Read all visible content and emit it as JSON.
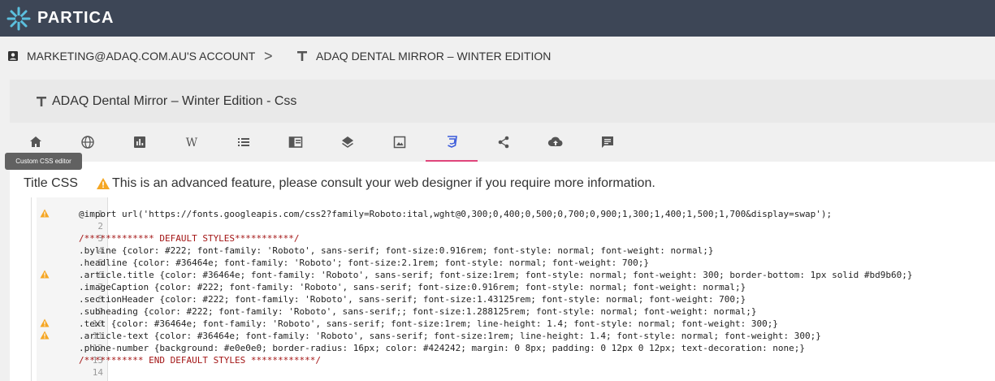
{
  "app": {
    "brand": "PARTICA"
  },
  "breadcrumb": {
    "account": "MARKETING@ADAQ.COM.AU'S ACCOUNT",
    "separator": ">",
    "document": "ADAQ DENTAL MIRROR – WINTER EDITION"
  },
  "panel": {
    "title": "ADAQ Dental Mirror – Winter Edition - Css"
  },
  "tabs": [
    {
      "icon": "home-icon"
    },
    {
      "icon": "globe-icon"
    },
    {
      "icon": "chart-icon"
    },
    {
      "icon": "wikipedia-icon",
      "glyph": "W"
    },
    {
      "icon": "list-icon"
    },
    {
      "icon": "layout-icon"
    },
    {
      "icon": "layers-icon"
    },
    {
      "icon": "image-icon"
    },
    {
      "icon": "css3-icon",
      "active": true
    },
    {
      "icon": "share-icon"
    },
    {
      "icon": "cloud-upload-icon"
    },
    {
      "icon": "comment-icon"
    }
  ],
  "tooltip": "Custom CSS editor",
  "title_css": {
    "label": "Title CSS",
    "warning": "This is an advanced feature, please consult your web designer if you require more information."
  },
  "colors": {
    "topbar": "#3d4656",
    "accent": "#e0457b",
    "warning": "#f5a623",
    "css_icon": "#3b5bdb"
  },
  "editor": {
    "lines": [
      {
        "n": "1",
        "warn": true,
        "text": "@import url('https://fonts.googleapis.com/css2?family=Roboto:ital,wght@0,300;0,400;0,500;0,700;0,900;1,300;1,400;1,500;1,700&display=swap');"
      },
      {
        "n": "2",
        "warn": false,
        "text": ""
      },
      {
        "n": "3",
        "warn": false,
        "text": "/************* DEFAULT STYLES***********/"
      },
      {
        "n": "4",
        "warn": false,
        "text": ".byline {color: #222; font-family: 'Roboto', sans-serif; font-size:0.916rem; font-style: normal; font-weight: normal;}"
      },
      {
        "n": "5",
        "warn": false,
        "text": ".headline {color: #36464e; font-family: 'Roboto'; font-size:2.1rem; font-style: normal; font-weight: 700;}"
      },
      {
        "n": "6",
        "warn": true,
        "text": ".article.title {color: #36464e; font-family: 'Roboto', sans-serif; font-size:1rem; font-style: normal; font-weight: 300; border-bottom: 1px solid #bd9b60;}"
      },
      {
        "n": "7",
        "warn": false,
        "text": ".imageCaption {color: #222; font-family: 'Roboto', sans-serif; font-size:0.916rem; font-style: normal; font-weight: normal;}"
      },
      {
        "n": "8",
        "warn": false,
        "text": ".sectionHeader {color: #222; font-family: 'Roboto', sans-serif; font-size:1.43125rem; font-style: normal; font-weight: 700;}"
      },
      {
        "n": "9",
        "warn": false,
        "text": ".subheading {color: #222; font-family: 'Roboto', sans-serif;; font-size:1.288125rem; font-style: normal; font-weight: normal;}"
      },
      {
        "n": "10",
        "warn": true,
        "text": ".text {color: #36464e; font-family: 'Roboto', sans-serif; font-size:1rem; line-height: 1.4; font-style: normal; font-weight: 300;}"
      },
      {
        "n": "11",
        "warn": true,
        "text": ".article-text {color: #36464e; font-family: 'Roboto', sans-serif; font-size:1rem; line-height: 1.4; font-style: normal; font-weight: 300;}"
      },
      {
        "n": "12",
        "warn": false,
        "text": ".phone-number {background: #e0e0e0; border-radius: 16px; color: #424242; margin: 0 8px; padding: 0 12px 0 12px; text-decoration: none;}"
      },
      {
        "n": "13",
        "warn": false,
        "text": "/*********** END DEFAULT STYLES ************/"
      },
      {
        "n": "14",
        "warn": false,
        "text": ""
      }
    ]
  }
}
